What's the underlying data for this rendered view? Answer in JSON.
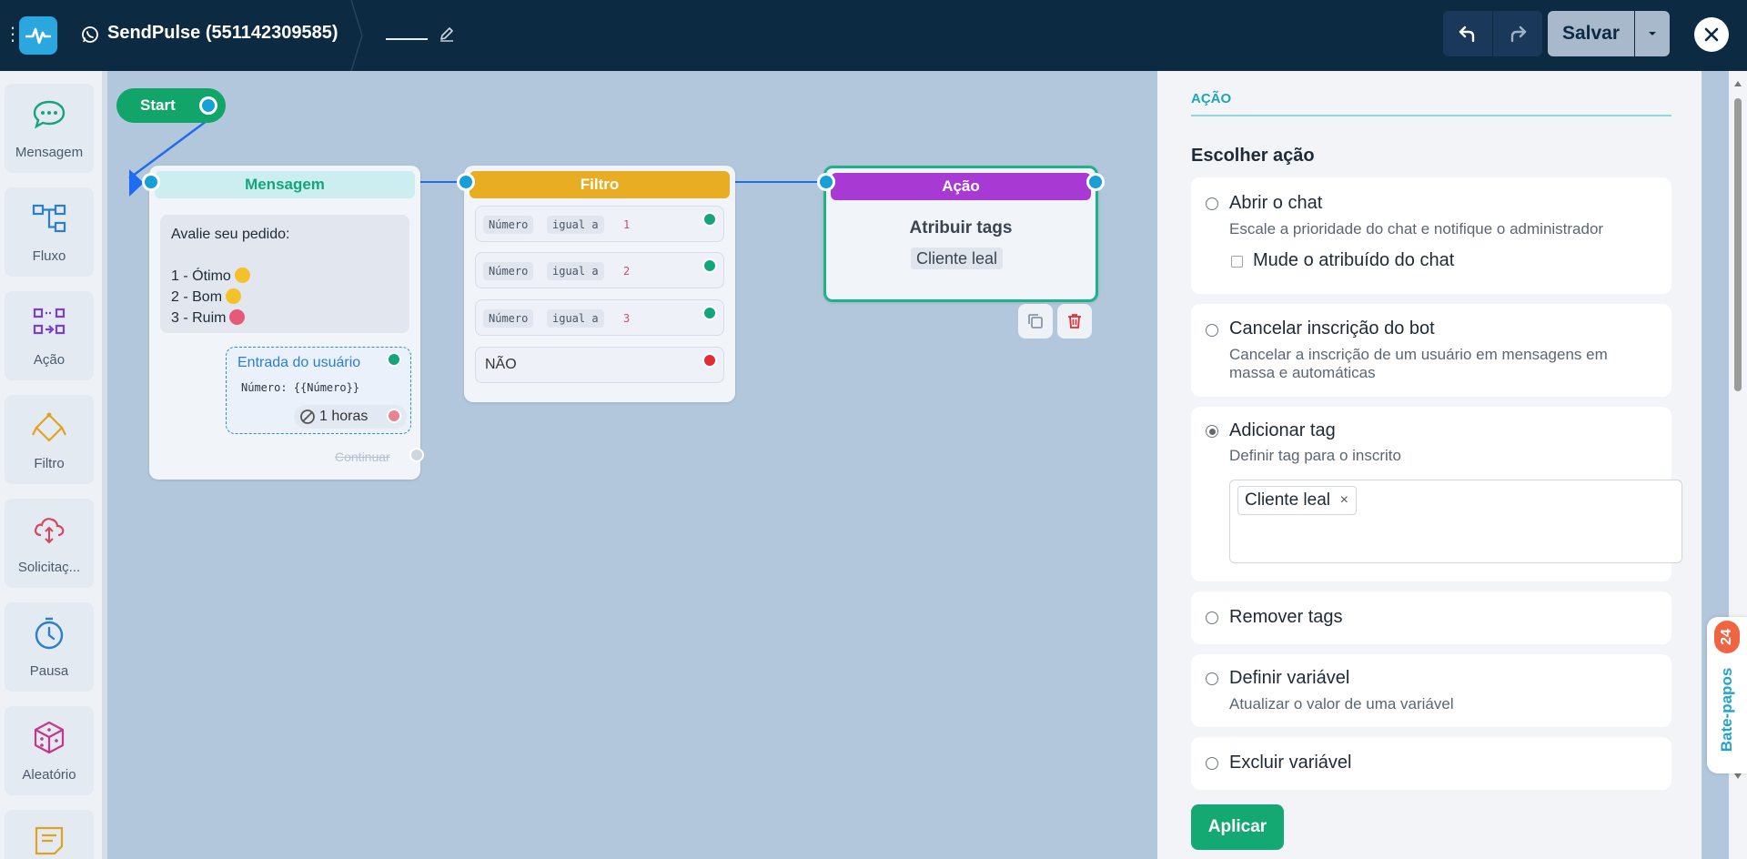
{
  "topbar": {
    "title": "SendPulse (551142309585)",
    "flow_name": "",
    "save_label": "Salvar"
  },
  "sidebar": {
    "items": [
      {
        "label": "Mensagem",
        "icon": "chat-bubble-icon"
      },
      {
        "label": "Fluxo",
        "icon": "flow-icon"
      },
      {
        "label": "Ação",
        "icon": "action-icon"
      },
      {
        "label": "Filtro",
        "icon": "filter-icon"
      },
      {
        "label": "Solicitaç...",
        "icon": "api-request-icon"
      },
      {
        "label": "Pausa",
        "icon": "clock-icon"
      },
      {
        "label": "Aleatório",
        "icon": "dice-icon"
      }
    ]
  },
  "canvas": {
    "start_label": "Start",
    "message_node": {
      "header": "Mensagem",
      "lines": [
        "Avalie seu pedido:",
        "",
        "1 - Ótimo",
        "2 - Bom",
        "3 - Ruim"
      ],
      "user_input_title": "Entrada do usuário",
      "user_input_var": "Número: {{Número}}",
      "timer": "1 horas",
      "continue_label": "Continuar"
    },
    "filter_node": {
      "header": "Filtro",
      "conditions": [
        {
          "field": "Número",
          "op": "igual a",
          "value": "1"
        },
        {
          "field": "Número",
          "op": "igual a",
          "value": "2"
        },
        {
          "field": "Número",
          "op": "igual a",
          "value": "3"
        }
      ],
      "else_label": "NÃO"
    },
    "action_node": {
      "header": "Ação",
      "title": "Atribuir tags",
      "tag": "Cliente leal"
    }
  },
  "panel": {
    "section_title": "AÇÃO",
    "choose_title": "Escolher ação",
    "options": [
      {
        "label": "Abrir o chat",
        "desc": "Escale a prioridade do chat e notifique o administrador",
        "checkbox_label": "Mude o atribuído do chat",
        "selected": false
      },
      {
        "label": "Cancelar inscrição do bot",
        "desc": "Cancelar a inscrição de um usuário em mensagens em massa e automáticas",
        "selected": false
      },
      {
        "label": "Adicionar tag",
        "desc": "Definir tag para o inscrito",
        "tag": "Cliente leal",
        "selected": true
      },
      {
        "label": "Remover tags",
        "selected": false
      },
      {
        "label": "Definir variável",
        "desc": "Atualizar o valor de uma variável",
        "selected": false
      },
      {
        "label": "Excluir variável",
        "selected": false
      }
    ],
    "apply_label": "Aplicar"
  },
  "chats_tab": {
    "label": "Bate-papos",
    "count": "24"
  },
  "colors": {
    "topbar": "#0d2a43",
    "accent_green": "#14a873",
    "filter_header": "#e9ad23",
    "action_header": "#a83ad3",
    "message_header": "#cdeef0"
  }
}
